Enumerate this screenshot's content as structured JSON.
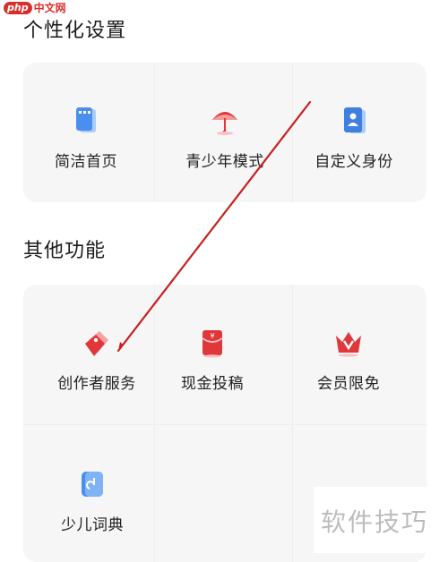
{
  "watermark_top": {
    "logo": "php",
    "site": "中文网"
  },
  "sections": [
    {
      "title": "个性化设置",
      "items": [
        {
          "label": "简洁首页",
          "icon": "simple-homepage-icon"
        },
        {
          "label": "青少年模式",
          "icon": "teen-mode-umbrella-icon"
        },
        {
          "label": "自定义身份",
          "icon": "custom-identity-icon"
        }
      ]
    },
    {
      "title": "其他功能",
      "items": [
        {
          "label": "创作者服务",
          "icon": "creator-service-tag-icon"
        },
        {
          "label": "现金投稿",
          "icon": "cash-submission-envelope-icon"
        },
        {
          "label": "会员限免",
          "icon": "vip-crown-icon"
        },
        {
          "label": "少儿词典",
          "icon": "kids-dictionary-icon"
        }
      ]
    }
  ],
  "watermark_bottom": "软件技巧",
  "colors": {
    "background": "#ffffff",
    "card": "#f6f6f7",
    "text": "#222222",
    "accent_red": "#e0373a",
    "accent_blue": "#4a8ff0",
    "arrow": "#c8211f"
  }
}
